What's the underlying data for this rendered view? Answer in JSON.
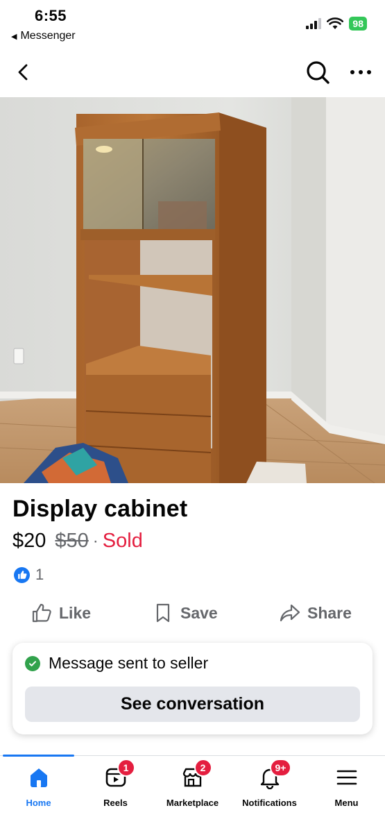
{
  "status_bar": {
    "time": "6:55",
    "back_app": "Messenger",
    "battery": "98"
  },
  "listing": {
    "title": "Display cabinet",
    "price": "$20",
    "original_price": "$50",
    "separator": "·",
    "status": "Sold",
    "like_count": "1"
  },
  "actions": {
    "like": "Like",
    "save": "Save",
    "share": "Share"
  },
  "toast": {
    "message": "Message sent to seller",
    "button": "See conversation"
  },
  "tabs": [
    {
      "label": "Home",
      "badge": ""
    },
    {
      "label": "Reels",
      "badge": "1"
    },
    {
      "label": "Marketplace",
      "badge": "2"
    },
    {
      "label": "Notifications",
      "badge": "9+"
    },
    {
      "label": "Menu",
      "badge": ""
    }
  ],
  "colors": {
    "accent": "#1877f2",
    "sold": "#e41e3f",
    "success": "#31a24c",
    "badge": "#e41e3f"
  },
  "icons": [
    "back-arrow-icon",
    "search-icon",
    "more-icon",
    "like-icon",
    "save-icon",
    "share-icon",
    "check-icon",
    "home-icon",
    "reels-icon",
    "marketplace-icon",
    "notifications-icon",
    "menu-icon"
  ],
  "photo": {
    "slide": 1,
    "total_slides": 2
  }
}
